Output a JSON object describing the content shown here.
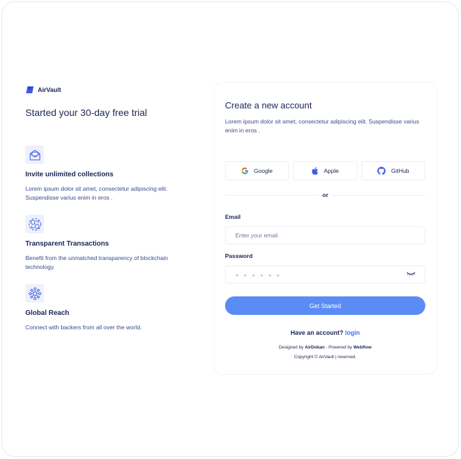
{
  "brand": {
    "name": "AirVault",
    "color": "#3f5fe6"
  },
  "left": {
    "title": "Started your 30-day free trial",
    "features": [
      {
        "icon": "envelope-icon",
        "title": "Invite unlimited collections",
        "desc": "Lorem ipsum dolor sit amet, consectetur adipiscing elit. Suspendisse varius enim in eros ."
      },
      {
        "icon": "exchange-icon",
        "title": "Transparent Transactions",
        "desc": "Benefit from the unmatched transparency of blockchain technology."
      },
      {
        "icon": "network-icon",
        "title": "Global Reach",
        "desc": "Connect with backers from all over the world."
      }
    ]
  },
  "form": {
    "title": "Create a new account",
    "desc": "Lorem ipsum dolor sit amet, consectetur adipiscing elit. Suspendisse varius enim in eros .",
    "social": [
      {
        "icon": "google-icon",
        "label": "Google"
      },
      {
        "icon": "apple-icon",
        "label": "Apple"
      },
      {
        "icon": "github-icon",
        "label": "GitHub"
      }
    ],
    "divider_text": "or",
    "email_label": "Email",
    "email_placeholder": "Enter your email",
    "password_label": "Password",
    "password_mask": "● ● ● ● ● ●",
    "submit_label": "Get Started",
    "have_account": "Have an account?",
    "login_link": "login",
    "accent": "#5b8cf5"
  },
  "footer": {
    "designed_by_prefix": "Designed by",
    "designer": "AirDokan",
    "powered_prefix": "- Powered by",
    "platform": "Webflow",
    "copyright": "Copyright © AirVault  | reserved."
  }
}
